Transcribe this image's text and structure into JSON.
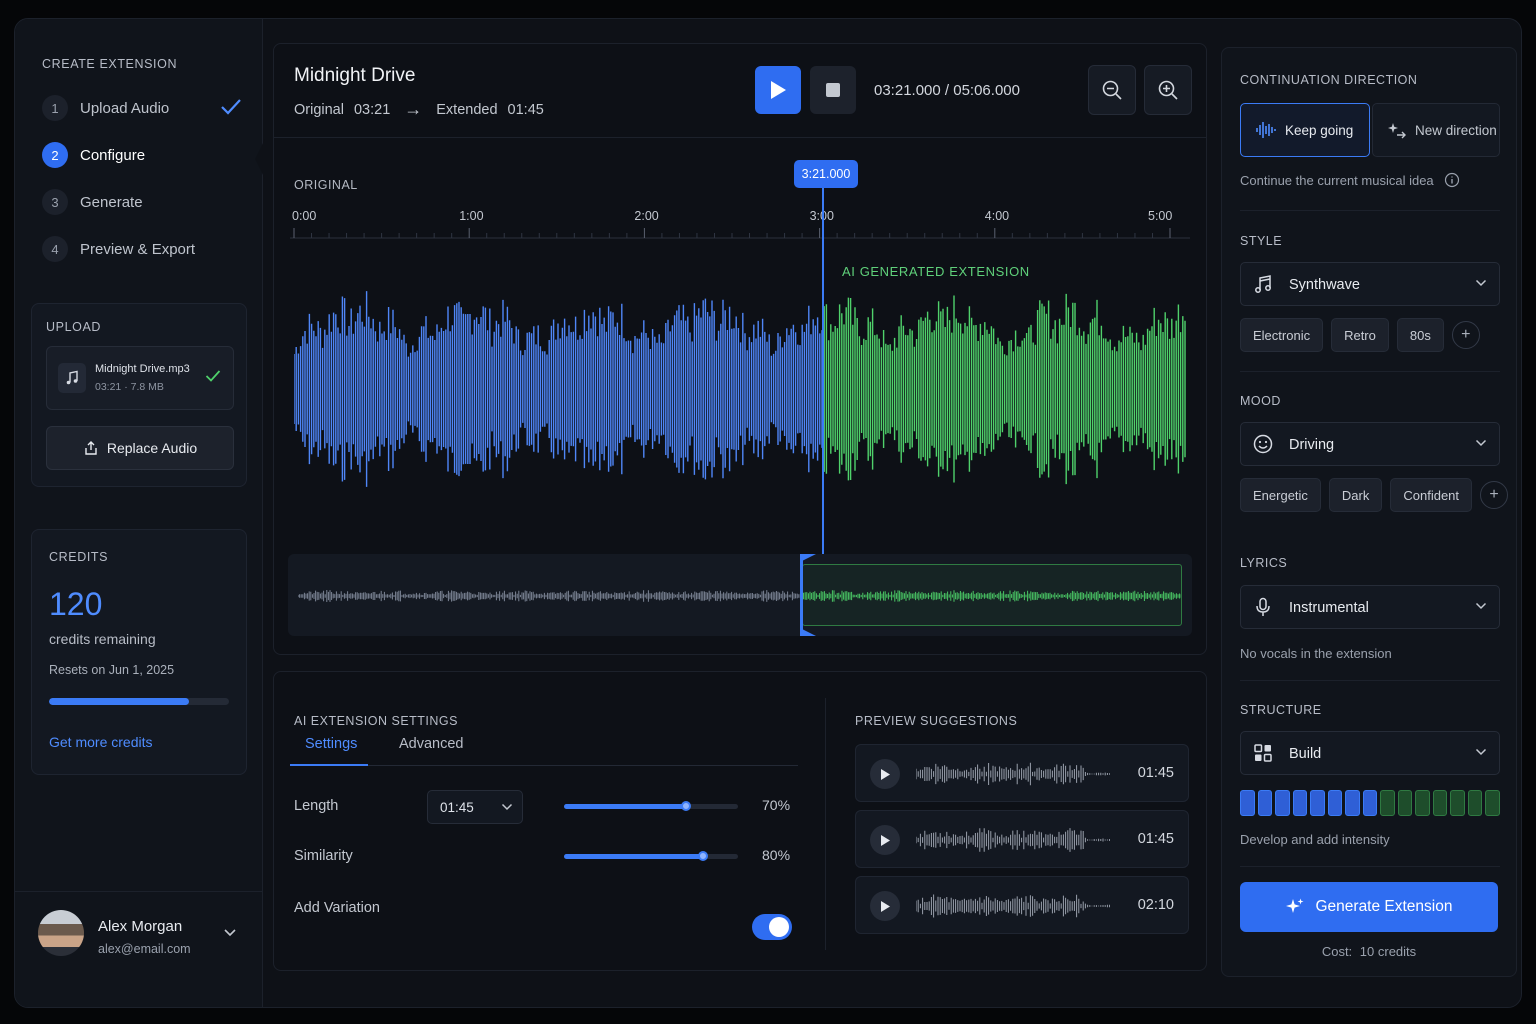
{
  "sidebar": {
    "section_label": "CREATE EXTENSION",
    "steps": [
      {
        "num": "1",
        "label": "Upload Audio",
        "state": "done"
      },
      {
        "num": "2",
        "label": "Configure",
        "state": "active"
      },
      {
        "num": "3",
        "label": "Generate",
        "state": "pending"
      },
      {
        "num": "4",
        "label": "Preview & Export",
        "state": "pending"
      }
    ],
    "upload": {
      "label": "UPLOAD",
      "file_name": "Midnight Drive.mp3",
      "file_meta": "03:21 · 7.8 MB",
      "replace_label": "Replace Audio"
    },
    "credits": {
      "label": "CREDITS",
      "value": "120",
      "sub": "credits remaining",
      "reset": "Resets on Jun 1, 2025",
      "progress": 0.78,
      "link": "Get more credits"
    },
    "user": {
      "name": "Alex Morgan",
      "email": "alex@email.com"
    }
  },
  "header": {
    "title": "Midnight Drive",
    "original_label": "Original",
    "original_time": "03:21",
    "arrow": "→",
    "extended_label": "Extended",
    "extended_time": "01:45",
    "time_readout": "03:21.000 / 05:06.000"
  },
  "waveform": {
    "section_label": "ORIGINAL",
    "ruler_ticks": [
      "0:00",
      "1:00",
      "2:00",
      "3:00",
      "4:00",
      "5:00"
    ],
    "playhead": "3:21.000",
    "playhead_fraction": 0.593,
    "ai_label": "AI GENERATED EXTENSION",
    "colors": {
      "original": "#4f86f7",
      "extension": "#4fd16b"
    }
  },
  "settings": {
    "title": "AI EXTENSION SETTINGS",
    "tabs": [
      "Settings",
      "Advanced"
    ],
    "length_label": "Length",
    "length_value": "01:45",
    "length_pct": "70%",
    "length_fraction": 0.7,
    "similarity_label": "Similarity",
    "similarity_pct": "80%",
    "similarity_fraction": 0.8,
    "variation_label": "Add Variation",
    "variation_on": true
  },
  "suggestions": {
    "title": "PREVIEW SUGGESTIONS",
    "items": [
      {
        "duration": "01:45"
      },
      {
        "duration": "01:45"
      },
      {
        "duration": "02:10"
      }
    ]
  },
  "right": {
    "direction_label": "CONTINUATION DIRECTION",
    "keep_going": "Keep going",
    "new_direction": "New direction",
    "direction_hint": "Continue the current musical idea",
    "style_label": "STYLE",
    "style_value": "Synthwave",
    "style_chips": [
      "Electronic",
      "Retro",
      "80s"
    ],
    "mood_label": "MOOD",
    "mood_value": "Driving",
    "mood_chips": [
      "Energetic",
      "Dark",
      "Confident"
    ],
    "lyrics_label": "LYRICS",
    "lyrics_value": "Instrumental",
    "lyrics_hint": "No vocals in the extension",
    "structure_label": "STRUCTURE",
    "structure_value": "Build",
    "structure_original_segments": 8,
    "structure_extension_segments": 7,
    "structure_hint": "Develop and add intensity",
    "generate_label": "Generate Extension",
    "cost_label": "Cost:",
    "cost_value": "10 credits"
  }
}
